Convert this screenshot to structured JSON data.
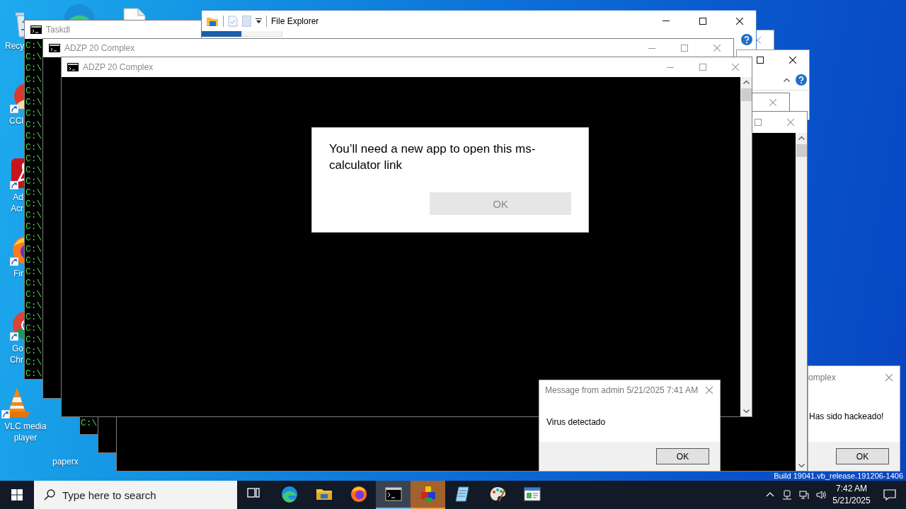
{
  "desktop_icons": [
    {
      "kind": "recycle-bin",
      "shortcut": false,
      "label_lines": [
        "Recy"
      ]
    },
    {
      "kind": "edge"
    },
    {
      "kind": "document"
    },
    {
      "kind": "ccleaner",
      "shortcut": true,
      "label_lines": [
        "CCl"
      ]
    },
    {
      "kind": "acrobat",
      "shortcut": true,
      "label_lines": [
        "Ad",
        "Acr"
      ]
    },
    {
      "kind": "firefox",
      "shortcut": true,
      "label_lines": [
        "Fir"
      ]
    },
    {
      "kind": "chrome",
      "shortcut": true,
      "label_lines": [
        "Go",
        "Chr"
      ]
    },
    {
      "kind": "vlc",
      "shortcut": true,
      "label_lines": [
        "VLC media",
        "player"
      ]
    },
    {
      "kind": "label",
      "label_lines": [
        "paperx"
      ]
    }
  ],
  "console_windows": [
    {
      "title": "Taskdl",
      "lines": [
        "C:\\",
        "C:\\",
        "C:\\",
        "C:\\",
        "C:\\",
        "C:\\",
        "C:\\",
        "C:\\",
        "C:\\",
        "C:\\",
        "C:\\",
        "C:\\",
        "C:\\",
        "C:\\",
        "C:\\",
        "C:\\",
        "C:\\",
        "C:\\",
        "C:\\",
        "C:\\",
        "C:\\",
        "C:\\",
        "C:\\",
        "C:\\",
        "C:\\",
        "C:\\",
        "C:\\",
        "C:\\",
        "C:\\",
        "C:\\"
      ]
    },
    {
      "title": "ADZP 20 Complex"
    },
    {
      "title": "ADZP 20 Complex"
    }
  ],
  "file_explorer": {
    "title": "File Explorer"
  },
  "back_consoles": [
    {
      "lines": [
        "C:\\"
      ]
    }
  ],
  "app_dialog": {
    "message": "You’ll need a new app to open this ms-calculator link",
    "button": {
      "label": "OK",
      "disabled": true
    }
  },
  "admin_message": {
    "title": "Message from admin 5/21/2025 7:41 AM",
    "body": "Virus detectado",
    "button": "OK"
  },
  "hack_message": {
    "title": "omplex",
    "body": "Has sido hackeado!",
    "button": "OK"
  },
  "build_text": "Build 19041.vb_release.191206-1406",
  "taskbar": {
    "search_placeholder": "Type here to search",
    "apps": [
      {
        "kind": "task-view",
        "active": false,
        "attention": false
      },
      {
        "kind": "edge",
        "active": false,
        "attention": false
      },
      {
        "kind": "explorer",
        "active": false,
        "attention": false
      },
      {
        "kind": "firefox",
        "active": false,
        "attention": false
      },
      {
        "kind": "cmd",
        "active": true,
        "attention": false
      },
      {
        "kind": "blocks",
        "active": false,
        "attention": true
      },
      {
        "kind": "notebook",
        "active": false,
        "attention": false
      },
      {
        "kind": "paint",
        "active": false,
        "attention": false
      },
      {
        "kind": "window",
        "active": false,
        "attention": false
      }
    ],
    "clock": {
      "time": "7:42 AM",
      "date": "5/21/2025"
    }
  }
}
